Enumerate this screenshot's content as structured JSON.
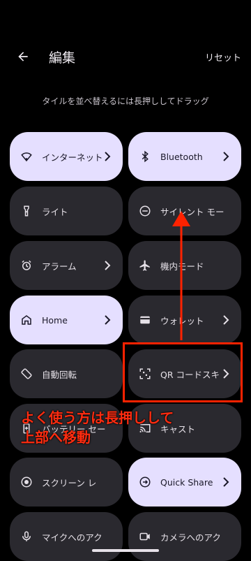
{
  "header": {
    "title": "編集",
    "reset_label": "リセット"
  },
  "hint": "タイルを並べ替えるには長押ししてドラッグ",
  "tiles": [
    {
      "label": "インターネット",
      "icon": "wifi-icon",
      "active": true,
      "chevron": true
    },
    {
      "label": "Bluetooth",
      "icon": "bluetooth-icon",
      "active": true,
      "chevron": true
    },
    {
      "label": "ライト",
      "icon": "flashlight-icon",
      "active": false,
      "chevron": false
    },
    {
      "label": "サイレント モード",
      "icon": "do-not-disturb-icon",
      "active": false,
      "chevron": false
    },
    {
      "label": "アラーム",
      "icon": "alarm-icon",
      "active": false,
      "chevron": true
    },
    {
      "label": "機内モード",
      "icon": "airplane-icon",
      "active": false,
      "chevron": false
    },
    {
      "label": "Home",
      "icon": "home-icon",
      "active": true,
      "chevron": true
    },
    {
      "label": "ウォレット",
      "icon": "wallet-icon",
      "active": false,
      "chevron": true
    },
    {
      "label": "自動回転",
      "icon": "auto-rotate-icon",
      "active": false,
      "chevron": false
    },
    {
      "label": "QR コードスキ",
      "icon": "qr-scanner-icon",
      "active": false,
      "chevron": true
    },
    {
      "label": "バッテリー セー",
      "icon": "battery-saver-icon",
      "active": false,
      "chevron": false
    },
    {
      "label": "キャスト",
      "icon": "cast-icon",
      "active": false,
      "chevron": false
    },
    {
      "label": "スクリーン レ",
      "icon": "screen-record-icon",
      "active": false,
      "chevron": false
    },
    {
      "label": "Quick Share",
      "icon": "quick-share-icon",
      "active": true,
      "chevron": true
    },
    {
      "label": "マイクへのアク",
      "icon": "mic-icon",
      "active": false,
      "chevron": false
    },
    {
      "label": "カメラへのアク",
      "icon": "camera-icon",
      "active": false,
      "chevron": false
    }
  ],
  "annotation": {
    "line1": "よく使う方は長押しして",
    "line2": "上部へ移動",
    "color": "#ff2c10"
  }
}
